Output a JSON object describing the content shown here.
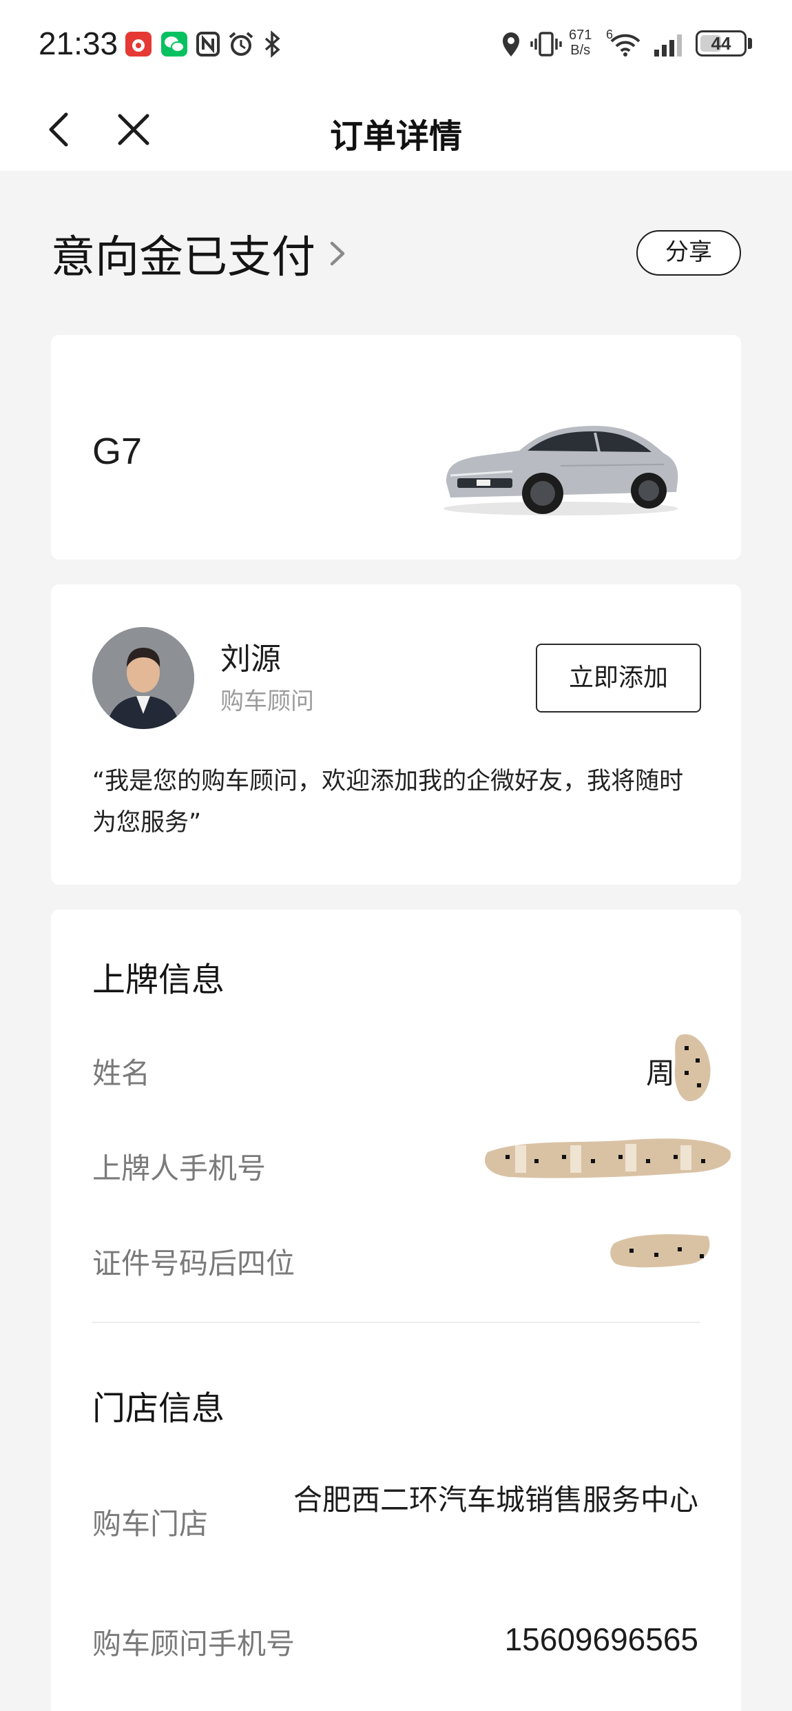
{
  "status_bar": {
    "time": "21:33",
    "net_speed_value": "671",
    "net_speed_unit": "B/s",
    "signal_type": "6",
    "battery_level": "44",
    "icons": [
      "app-notification-icon",
      "wechat-icon",
      "nfc-icon",
      "alarm-icon",
      "bluetooth-icon",
      "location-icon",
      "vibrate-icon",
      "wifi-icon",
      "cellular-signal-icon",
      "battery-icon"
    ]
  },
  "nav": {
    "title": "订单详情",
    "back_icon": "chevron-left-icon",
    "close_icon": "close-icon"
  },
  "order": {
    "status": "意向金已支付",
    "share_label": "分享"
  },
  "car": {
    "model": "G7",
    "color": "#b8bcc2"
  },
  "advisor": {
    "name": "刘源",
    "role": "购车顾问",
    "add_label": "立即添加",
    "quote": "“我是您的购车顾问，欢迎添加我的企微好友，我将随时为您服务”"
  },
  "registration": {
    "title": "上牌信息",
    "name_label": "姓名",
    "name_value": "周",
    "phone_label": "上牌人手机号",
    "id_label": "证件号码后四位"
  },
  "store": {
    "title": "门店信息",
    "store_label": "购车门店",
    "store_value": "合肥西二环汽车城销售服务中心",
    "advisor_phone_label": "购车顾问手机号",
    "advisor_phone_value": "15609696565"
  }
}
